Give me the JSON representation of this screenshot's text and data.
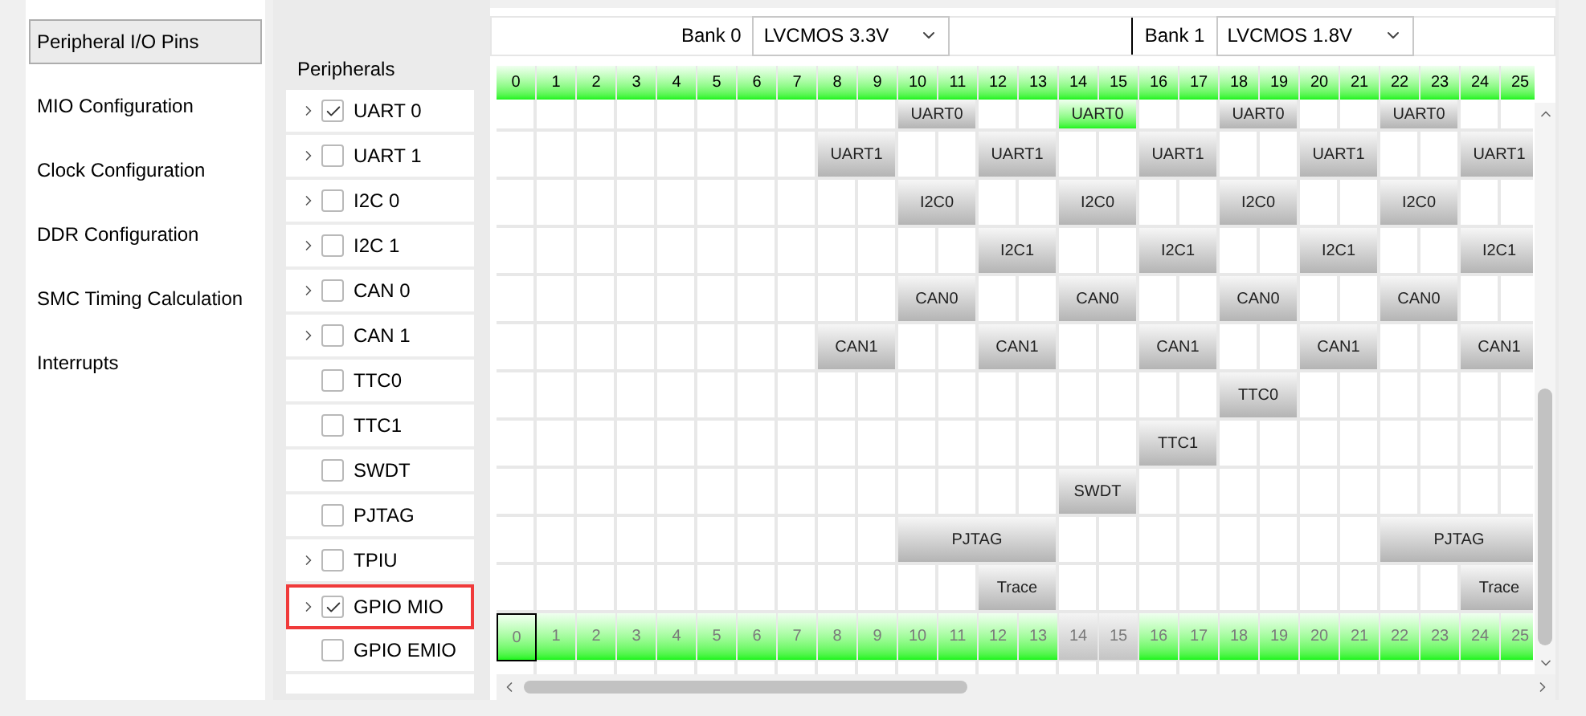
{
  "nav": {
    "items": [
      {
        "label": "Peripheral I/O Pins",
        "selected": true
      },
      {
        "label": "MIO Configuration",
        "selected": false
      },
      {
        "label": "Clock Configuration",
        "selected": false
      },
      {
        "label": "DDR Configuration",
        "selected": false
      },
      {
        "label": "SMC Timing Calculation",
        "selected": false
      },
      {
        "label": "Interrupts",
        "selected": false
      }
    ]
  },
  "peripherals": {
    "title": "Peripherals",
    "items": [
      {
        "label": "UART 0",
        "checked": true,
        "expandable": true,
        "highlighted": false
      },
      {
        "label": "UART 1",
        "checked": false,
        "expandable": true,
        "highlighted": false
      },
      {
        "label": "I2C 0",
        "checked": false,
        "expandable": true,
        "highlighted": false
      },
      {
        "label": "I2C 1",
        "checked": false,
        "expandable": true,
        "highlighted": false
      },
      {
        "label": "CAN 0",
        "checked": false,
        "expandable": true,
        "highlighted": false
      },
      {
        "label": "CAN 1",
        "checked": false,
        "expandable": true,
        "highlighted": false
      },
      {
        "label": "TTC0",
        "checked": false,
        "expandable": false,
        "highlighted": false
      },
      {
        "label": "TTC1",
        "checked": false,
        "expandable": false,
        "highlighted": false
      },
      {
        "label": "SWDT",
        "checked": false,
        "expandable": false,
        "highlighted": false
      },
      {
        "label": "PJTAG",
        "checked": false,
        "expandable": false,
        "highlighted": false
      },
      {
        "label": "TPIU",
        "checked": false,
        "expandable": true,
        "highlighted": false
      },
      {
        "label": "GPIO MIO",
        "checked": true,
        "expandable": true,
        "highlighted": true
      },
      {
        "label": "GPIO EMIO",
        "checked": false,
        "expandable": false,
        "highlighted": false
      }
    ]
  },
  "banks": [
    {
      "label": "Bank 0",
      "value": "LVCMOS 3.3V"
    },
    {
      "label": "Bank 1",
      "value": "LVCMOS 1.8V"
    }
  ],
  "pin_header": [
    "0",
    "1",
    "2",
    "3",
    "4",
    "5",
    "6",
    "7",
    "8",
    "9",
    "10",
    "11",
    "12",
    "13",
    "14",
    "15",
    "16",
    "17",
    "18",
    "19",
    "20",
    "21",
    "22",
    "23",
    "24",
    "25"
  ],
  "grid_rows": [
    {
      "kind": "blocks",
      "cells": [
        {
          "kind": "empty"
        },
        {
          "kind": "empty"
        },
        {
          "kind": "empty"
        },
        {
          "kind": "empty"
        },
        {
          "kind": "empty"
        },
        {
          "kind": "empty"
        },
        {
          "kind": "empty"
        },
        {
          "kind": "empty"
        },
        {
          "kind": "empty"
        },
        {
          "kind": "empty"
        },
        {
          "kind": "pair",
          "label": "UART0",
          "selected": false
        },
        {
          "kind": "empty"
        },
        {
          "kind": "empty"
        },
        {
          "kind": "pair",
          "label": "UART0",
          "selected": true
        },
        {
          "kind": "empty"
        },
        {
          "kind": "empty"
        },
        {
          "kind": "pair",
          "label": "UART0",
          "selected": false
        },
        {
          "kind": "empty"
        },
        {
          "kind": "empty"
        },
        {
          "kind": "pair",
          "label": "UART0",
          "selected": false
        },
        {
          "kind": "empty"
        },
        {
          "kind": "empty"
        }
      ]
    },
    {
      "kind": "blocks",
      "cells": [
        {
          "kind": "empty"
        },
        {
          "kind": "empty"
        },
        {
          "kind": "empty"
        },
        {
          "kind": "empty"
        },
        {
          "kind": "empty"
        },
        {
          "kind": "empty"
        },
        {
          "kind": "empty"
        },
        {
          "kind": "empty"
        },
        {
          "kind": "pair",
          "label": "UART1",
          "selected": false
        },
        {
          "kind": "empty"
        },
        {
          "kind": "empty"
        },
        {
          "kind": "pair",
          "label": "UART1",
          "selected": false
        },
        {
          "kind": "empty"
        },
        {
          "kind": "empty"
        },
        {
          "kind": "pair",
          "label": "UART1",
          "selected": false
        },
        {
          "kind": "empty"
        },
        {
          "kind": "empty"
        },
        {
          "kind": "pair",
          "label": "UART1",
          "selected": false
        },
        {
          "kind": "empty"
        },
        {
          "kind": "empty"
        },
        {
          "kind": "pair",
          "label": "UART1",
          "selected": false
        }
      ]
    },
    {
      "kind": "blocks",
      "cells": [
        {
          "kind": "empty"
        },
        {
          "kind": "empty"
        },
        {
          "kind": "empty"
        },
        {
          "kind": "empty"
        },
        {
          "kind": "empty"
        },
        {
          "kind": "empty"
        },
        {
          "kind": "empty"
        },
        {
          "kind": "empty"
        },
        {
          "kind": "empty"
        },
        {
          "kind": "empty"
        },
        {
          "kind": "pair",
          "label": "I2C0",
          "selected": false
        },
        {
          "kind": "empty"
        },
        {
          "kind": "empty"
        },
        {
          "kind": "pair",
          "label": "I2C0",
          "selected": false
        },
        {
          "kind": "empty"
        },
        {
          "kind": "empty"
        },
        {
          "kind": "pair",
          "label": "I2C0",
          "selected": false
        },
        {
          "kind": "empty"
        },
        {
          "kind": "empty"
        },
        {
          "kind": "pair",
          "label": "I2C0",
          "selected": false
        },
        {
          "kind": "empty"
        },
        {
          "kind": "empty"
        }
      ]
    },
    {
      "kind": "blocks",
      "cells": [
        {
          "kind": "empty"
        },
        {
          "kind": "empty"
        },
        {
          "kind": "empty"
        },
        {
          "kind": "empty"
        },
        {
          "kind": "empty"
        },
        {
          "kind": "empty"
        },
        {
          "kind": "empty"
        },
        {
          "kind": "empty"
        },
        {
          "kind": "empty"
        },
        {
          "kind": "empty"
        },
        {
          "kind": "empty"
        },
        {
          "kind": "empty"
        },
        {
          "kind": "pair",
          "label": "I2C1",
          "selected": false
        },
        {
          "kind": "empty"
        },
        {
          "kind": "empty"
        },
        {
          "kind": "pair",
          "label": "I2C1",
          "selected": false
        },
        {
          "kind": "empty"
        },
        {
          "kind": "empty"
        },
        {
          "kind": "pair",
          "label": "I2C1",
          "selected": false
        },
        {
          "kind": "empty"
        },
        {
          "kind": "empty"
        },
        {
          "kind": "pair",
          "label": "I2C1",
          "selected": false
        }
      ]
    },
    {
      "kind": "blocks",
      "cells": [
        {
          "kind": "empty"
        },
        {
          "kind": "empty"
        },
        {
          "kind": "empty"
        },
        {
          "kind": "empty"
        },
        {
          "kind": "empty"
        },
        {
          "kind": "empty"
        },
        {
          "kind": "empty"
        },
        {
          "kind": "empty"
        },
        {
          "kind": "empty"
        },
        {
          "kind": "empty"
        },
        {
          "kind": "pair",
          "label": "CAN0",
          "selected": false
        },
        {
          "kind": "empty"
        },
        {
          "kind": "empty"
        },
        {
          "kind": "pair",
          "label": "CAN0",
          "selected": false
        },
        {
          "kind": "empty"
        },
        {
          "kind": "empty"
        },
        {
          "kind": "pair",
          "label": "CAN0",
          "selected": false
        },
        {
          "kind": "empty"
        },
        {
          "kind": "empty"
        },
        {
          "kind": "pair",
          "label": "CAN0",
          "selected": false
        },
        {
          "kind": "empty"
        },
        {
          "kind": "empty"
        }
      ]
    },
    {
      "kind": "blocks",
      "cells": [
        {
          "kind": "empty"
        },
        {
          "kind": "empty"
        },
        {
          "kind": "empty"
        },
        {
          "kind": "empty"
        },
        {
          "kind": "empty"
        },
        {
          "kind": "empty"
        },
        {
          "kind": "empty"
        },
        {
          "kind": "empty"
        },
        {
          "kind": "pair",
          "label": "CAN1",
          "selected": false
        },
        {
          "kind": "empty"
        },
        {
          "kind": "empty"
        },
        {
          "kind": "pair",
          "label": "CAN1",
          "selected": false
        },
        {
          "kind": "empty"
        },
        {
          "kind": "empty"
        },
        {
          "kind": "pair",
          "label": "CAN1",
          "selected": false
        },
        {
          "kind": "empty"
        },
        {
          "kind": "empty"
        },
        {
          "kind": "pair",
          "label": "CAN1",
          "selected": false
        },
        {
          "kind": "empty"
        },
        {
          "kind": "empty"
        },
        {
          "kind": "pair",
          "label": "CAN1",
          "selected": false
        }
      ]
    },
    {
      "kind": "blocks",
      "cells": [
        {
          "kind": "empty"
        },
        {
          "kind": "empty"
        },
        {
          "kind": "empty"
        },
        {
          "kind": "empty"
        },
        {
          "kind": "empty"
        },
        {
          "kind": "empty"
        },
        {
          "kind": "empty"
        },
        {
          "kind": "empty"
        },
        {
          "kind": "empty"
        },
        {
          "kind": "empty"
        },
        {
          "kind": "empty"
        },
        {
          "kind": "empty"
        },
        {
          "kind": "empty"
        },
        {
          "kind": "empty"
        },
        {
          "kind": "empty"
        },
        {
          "kind": "empty"
        },
        {
          "kind": "empty"
        },
        {
          "kind": "empty"
        },
        {
          "kind": "pair",
          "label": "TTC0",
          "selected": false
        },
        {
          "kind": "empty"
        },
        {
          "kind": "empty"
        },
        {
          "kind": "empty"
        },
        {
          "kind": "empty"
        },
        {
          "kind": "empty"
        },
        {
          "kind": "empty"
        }
      ]
    },
    {
      "kind": "blocks",
      "cells": [
        {
          "kind": "empty"
        },
        {
          "kind": "empty"
        },
        {
          "kind": "empty"
        },
        {
          "kind": "empty"
        },
        {
          "kind": "empty"
        },
        {
          "kind": "empty"
        },
        {
          "kind": "empty"
        },
        {
          "kind": "empty"
        },
        {
          "kind": "empty"
        },
        {
          "kind": "empty"
        },
        {
          "kind": "empty"
        },
        {
          "kind": "empty"
        },
        {
          "kind": "empty"
        },
        {
          "kind": "empty"
        },
        {
          "kind": "empty"
        },
        {
          "kind": "empty"
        },
        {
          "kind": "pair",
          "label": "TTC1",
          "selected": false
        },
        {
          "kind": "empty"
        },
        {
          "kind": "empty"
        },
        {
          "kind": "empty"
        },
        {
          "kind": "empty"
        },
        {
          "kind": "empty"
        },
        {
          "kind": "empty"
        },
        {
          "kind": "empty"
        },
        {
          "kind": "empty"
        }
      ]
    },
    {
      "kind": "blocks",
      "cells": [
        {
          "kind": "empty"
        },
        {
          "kind": "empty"
        },
        {
          "kind": "empty"
        },
        {
          "kind": "empty"
        },
        {
          "kind": "empty"
        },
        {
          "kind": "empty"
        },
        {
          "kind": "empty"
        },
        {
          "kind": "empty"
        },
        {
          "kind": "empty"
        },
        {
          "kind": "empty"
        },
        {
          "kind": "empty"
        },
        {
          "kind": "empty"
        },
        {
          "kind": "empty"
        },
        {
          "kind": "empty"
        },
        {
          "kind": "pair",
          "label": "SWDT",
          "selected": false
        },
        {
          "kind": "empty"
        },
        {
          "kind": "empty"
        },
        {
          "kind": "empty"
        },
        {
          "kind": "empty"
        },
        {
          "kind": "empty"
        },
        {
          "kind": "empty"
        },
        {
          "kind": "empty"
        },
        {
          "kind": "empty"
        },
        {
          "kind": "empty"
        },
        {
          "kind": "empty"
        }
      ]
    },
    {
      "kind": "blocks",
      "cells": [
        {
          "kind": "empty"
        },
        {
          "kind": "empty"
        },
        {
          "kind": "empty"
        },
        {
          "kind": "empty"
        },
        {
          "kind": "empty"
        },
        {
          "kind": "empty"
        },
        {
          "kind": "empty"
        },
        {
          "kind": "empty"
        },
        {
          "kind": "empty"
        },
        {
          "kind": "empty"
        },
        {
          "kind": "quad",
          "label": "PJTAG",
          "selected": false
        },
        {
          "kind": "empty"
        },
        {
          "kind": "empty"
        },
        {
          "kind": "empty"
        },
        {
          "kind": "empty"
        },
        {
          "kind": "empty"
        },
        {
          "kind": "empty"
        },
        {
          "kind": "empty"
        },
        {
          "kind": "empty"
        },
        {
          "kind": "quad",
          "label": "PJTAG",
          "selected": false
        }
      ]
    },
    {
      "kind": "blocks",
      "cells": [
        {
          "kind": "empty"
        },
        {
          "kind": "empty"
        },
        {
          "kind": "empty"
        },
        {
          "kind": "empty"
        },
        {
          "kind": "empty"
        },
        {
          "kind": "empty"
        },
        {
          "kind": "empty"
        },
        {
          "kind": "empty"
        },
        {
          "kind": "empty"
        },
        {
          "kind": "empty"
        },
        {
          "kind": "empty"
        },
        {
          "kind": "empty"
        },
        {
          "kind": "pair",
          "label": "Trace",
          "selected": false
        },
        {
          "kind": "empty"
        },
        {
          "kind": "empty"
        },
        {
          "kind": "empty"
        },
        {
          "kind": "empty"
        },
        {
          "kind": "empty"
        },
        {
          "kind": "empty"
        },
        {
          "kind": "empty"
        },
        {
          "kind": "empty"
        },
        {
          "kind": "empty"
        },
        {
          "kind": "empty"
        },
        {
          "kind": "pair",
          "label": "Trace",
          "selected": false
        }
      ]
    },
    {
      "kind": "pins",
      "pins": [
        {
          "label": "0",
          "enabled": true,
          "focused": true
        },
        {
          "label": "1",
          "enabled": true,
          "focused": false
        },
        {
          "label": "2",
          "enabled": true,
          "focused": false
        },
        {
          "label": "3",
          "enabled": true,
          "focused": false
        },
        {
          "label": "4",
          "enabled": true,
          "focused": false
        },
        {
          "label": "5",
          "enabled": true,
          "focused": false
        },
        {
          "label": "6",
          "enabled": true,
          "focused": false
        },
        {
          "label": "7",
          "enabled": true,
          "focused": false
        },
        {
          "label": "8",
          "enabled": true,
          "focused": false
        },
        {
          "label": "9",
          "enabled": true,
          "focused": false
        },
        {
          "label": "10",
          "enabled": true,
          "focused": false
        },
        {
          "label": "11",
          "enabled": true,
          "focused": false
        },
        {
          "label": "12",
          "enabled": true,
          "focused": false
        },
        {
          "label": "13",
          "enabled": true,
          "focused": false
        },
        {
          "label": "14",
          "enabled": false,
          "focused": false
        },
        {
          "label": "15",
          "enabled": false,
          "focused": false
        },
        {
          "label": "16",
          "enabled": true,
          "focused": false
        },
        {
          "label": "17",
          "enabled": true,
          "focused": false
        },
        {
          "label": "18",
          "enabled": true,
          "focused": false
        },
        {
          "label": "19",
          "enabled": true,
          "focused": false
        },
        {
          "label": "20",
          "enabled": true,
          "focused": false
        },
        {
          "label": "21",
          "enabled": true,
          "focused": false
        },
        {
          "label": "22",
          "enabled": true,
          "focused": false
        },
        {
          "label": "23",
          "enabled": true,
          "focused": false
        },
        {
          "label": "24",
          "enabled": true,
          "focused": false
        },
        {
          "label": "25",
          "enabled": true,
          "focused": false
        }
      ]
    }
  ]
}
